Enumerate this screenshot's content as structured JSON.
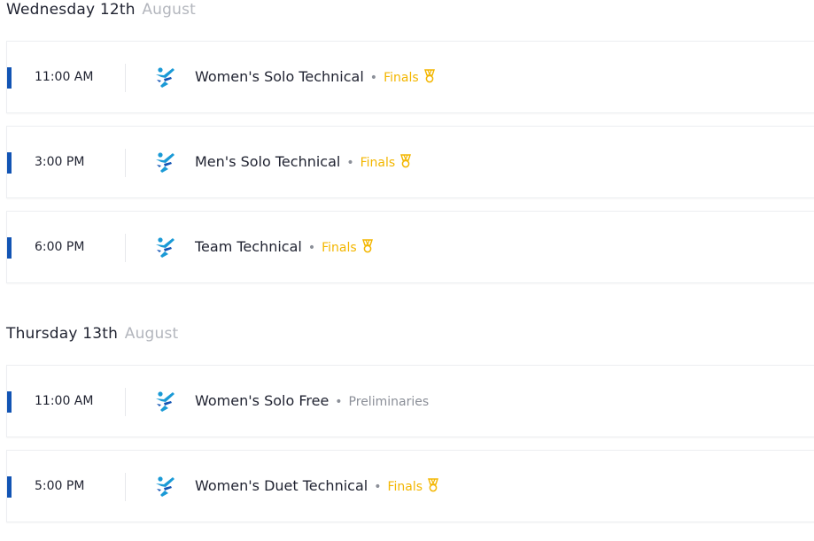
{
  "days": [
    {
      "day_name": "Wednesday 12th",
      "month": "August",
      "events": [
        {
          "time": "11:00 AM",
          "name": "Women's Solo Technical",
          "stage": "Finals",
          "medal": true
        },
        {
          "time": "3:00 PM",
          "name": "Men's Solo Technical",
          "stage": "Finals",
          "medal": true
        },
        {
          "time": "6:00 PM",
          "name": "Team Technical",
          "stage": "Finals",
          "medal": true
        }
      ]
    },
    {
      "day_name": "Thursday 13th",
      "month": "August",
      "events": [
        {
          "time": "11:00 AM",
          "name": "Women's Solo Free",
          "stage": "Preliminaries",
          "medal": false
        },
        {
          "time": "5:00 PM",
          "name": "Women's Duet Technical",
          "stage": "Finals",
          "medal": true
        }
      ]
    }
  ],
  "separator": "•",
  "colors": {
    "accent_bar": "#1254b4",
    "finals": "#f3b600",
    "preliminaries": "#8b8f98",
    "icon_blue": "#1a9ad6",
    "icon_dark": "#1254b4"
  },
  "icons": {
    "sport": "artistic-swimming-icon",
    "medal": "medal-icon"
  }
}
